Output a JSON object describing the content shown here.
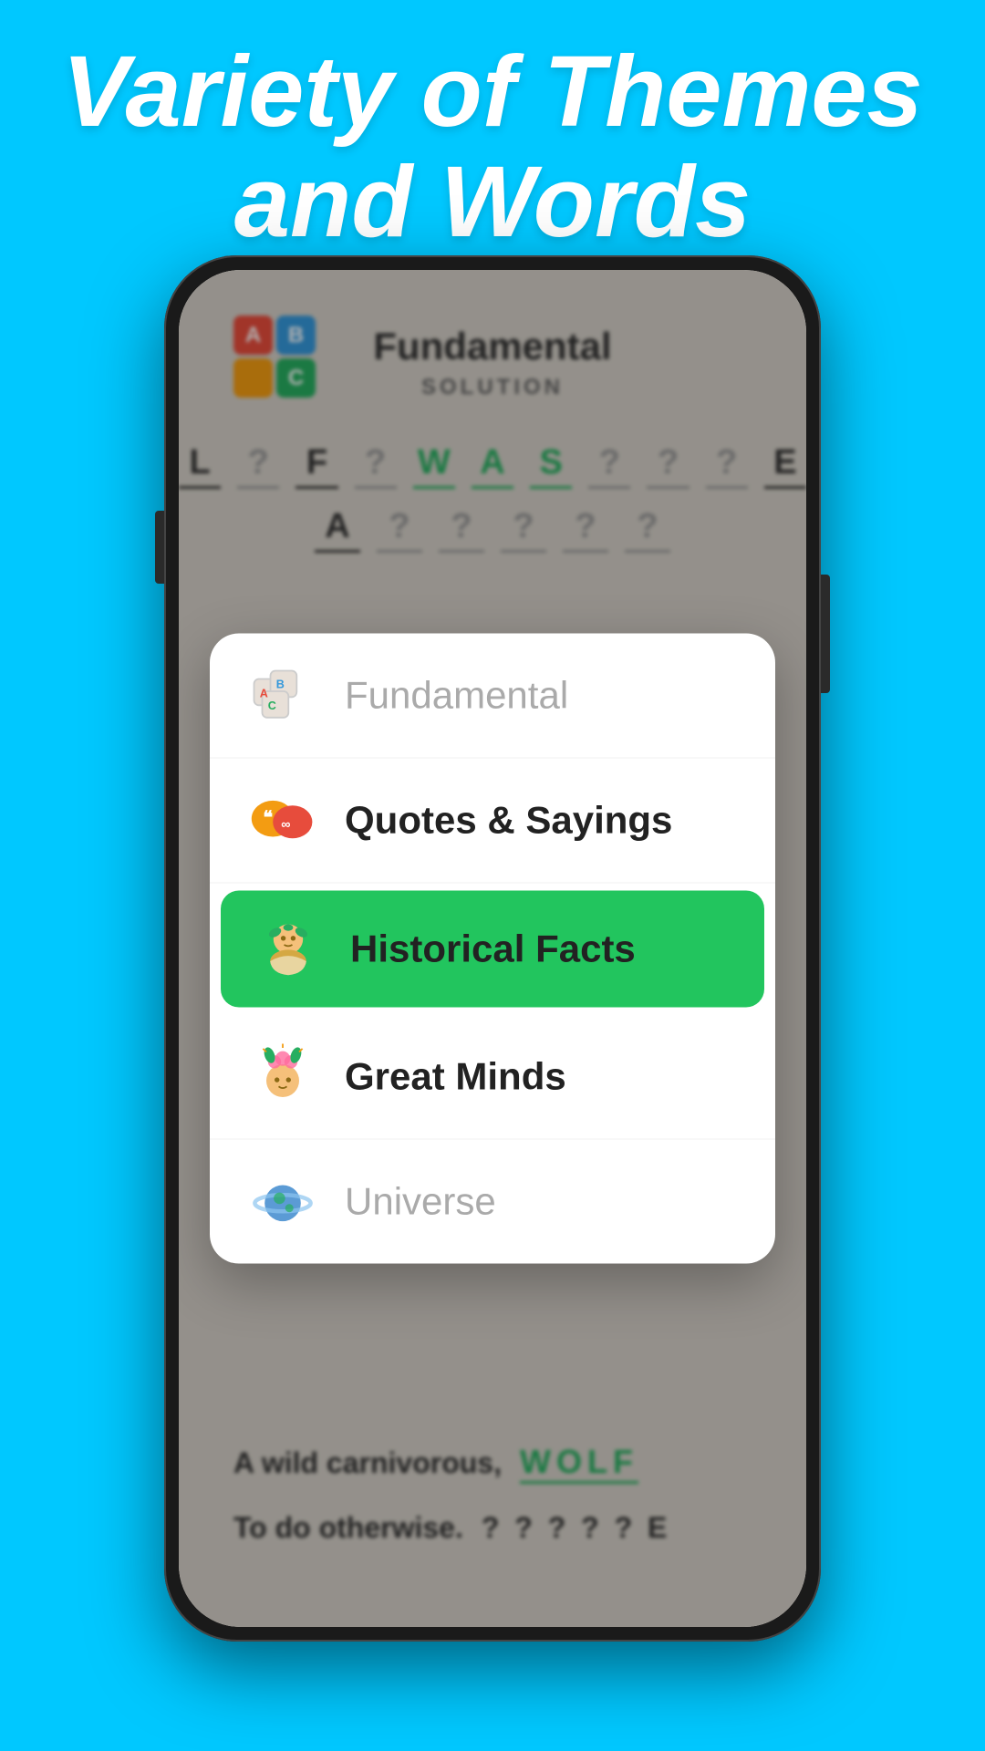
{
  "header": {
    "title_line1": "Variety of Themes",
    "title_line2": "and Words",
    "background_color": "#00c8ff"
  },
  "phone": {
    "game_title": "Fundamental",
    "game_subtitle": "SOLUTION",
    "puzzle_row1": [
      "L",
      "?",
      "F",
      "?",
      "W",
      "A",
      "S",
      "?",
      "?",
      "?",
      "E"
    ],
    "puzzle_row2": [
      "A",
      "?",
      "?",
      "?",
      "?",
      "?"
    ],
    "clue1_text": "A wild carnivorous,",
    "clue1_answer": "WOLF",
    "clue2_text": "To do otherwise.",
    "clue2_answer": "? ? ? ? ? E"
  },
  "modal": {
    "themes": [
      {
        "id": "fundamental",
        "label": "Fundamental",
        "icon_type": "blocks",
        "selected": false,
        "muted": true
      },
      {
        "id": "quotes",
        "label": "Quotes & Sayings",
        "icon_type": "speech",
        "selected": false,
        "muted": false
      },
      {
        "id": "historical",
        "label": "Historical Facts",
        "icon_type": "historical",
        "selected": true,
        "muted": false
      },
      {
        "id": "minds",
        "label": "Great Minds",
        "icon_type": "brain",
        "selected": false,
        "muted": false
      },
      {
        "id": "universe",
        "label": "Universe",
        "icon_type": "planet",
        "selected": false,
        "muted": true
      }
    ]
  },
  "colors": {
    "background": "#00c8ff",
    "selected_green": "#22c55e",
    "text_dark": "#222222",
    "text_muted": "#aaaaaa",
    "letter_green": "#27ae60"
  }
}
